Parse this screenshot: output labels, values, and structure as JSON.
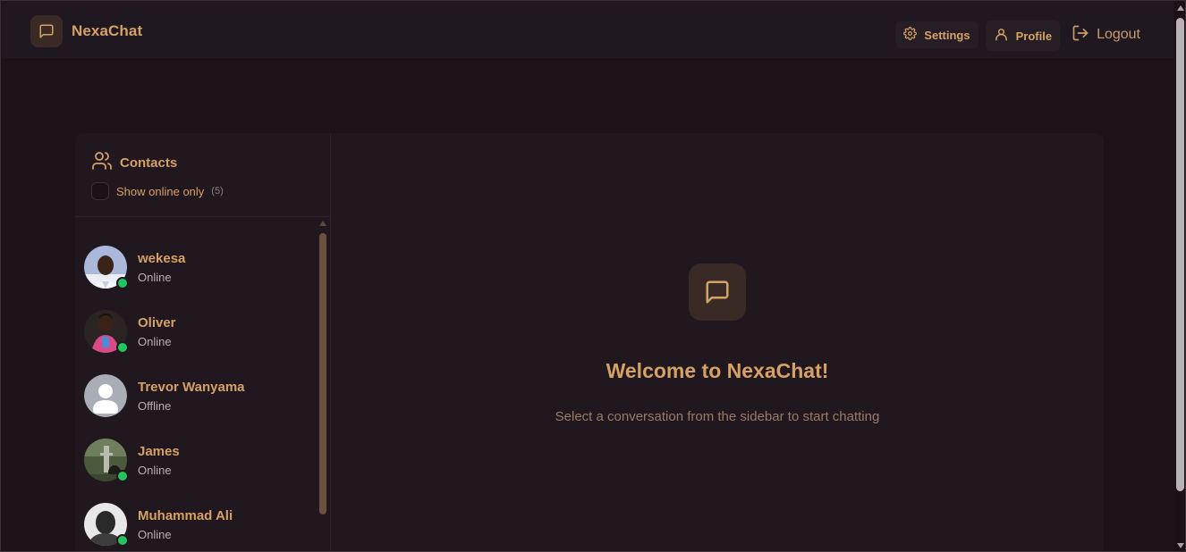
{
  "app": {
    "name": "NexaChat",
    "icon": "message-square-icon"
  },
  "nav": {
    "settings": {
      "label": "Settings",
      "icon": "gear-icon"
    },
    "profile": {
      "label": "Profile",
      "icon": "user-icon"
    },
    "logout": {
      "label": "Logout",
      "icon": "logout-icon"
    }
  },
  "sidebar": {
    "title": "Contacts",
    "title_icon": "users-icon",
    "filter_label": "Show online only",
    "filter_checked": false,
    "online_count": "(5)",
    "contacts": [
      {
        "name": "wekesa",
        "status": "Online",
        "online": true,
        "avatar": "photo"
      },
      {
        "name": "Oliver",
        "status": "Online",
        "online": true,
        "avatar": "photo"
      },
      {
        "name": "Trevor Wanyama",
        "status": "Offline",
        "online": false,
        "avatar": "default-avatar-icon"
      },
      {
        "name": "James",
        "status": "Online",
        "online": true,
        "avatar": "photo"
      },
      {
        "name": "Muhammad Ali",
        "status": "Online",
        "online": true,
        "avatar": "photo"
      }
    ]
  },
  "welcome": {
    "icon": "message-square-icon",
    "title": "Welcome to NexaChat!",
    "subtitle": "Select a conversation from the sidebar to start chatting"
  },
  "colors": {
    "accent": "#d6a165",
    "background": "#1c1419",
    "panel": "#21171f",
    "online": "#22c55e"
  }
}
